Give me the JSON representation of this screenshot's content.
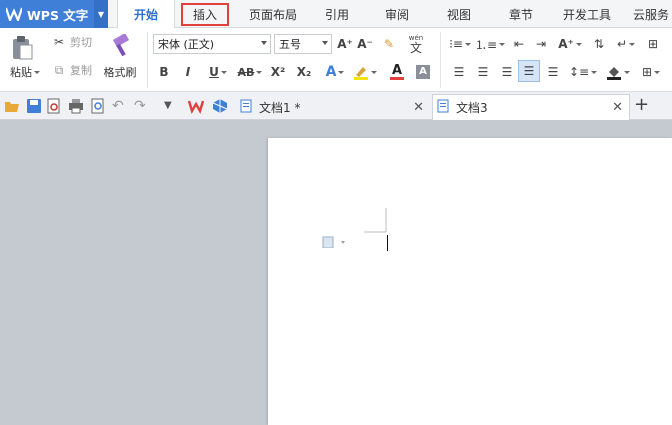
{
  "app": {
    "name": "WPS 文字"
  },
  "menu_tabs": [
    {
      "label": "开始",
      "active": true
    },
    {
      "label": "插入",
      "highlighted": true
    },
    {
      "label": "页面布局"
    },
    {
      "label": "引用"
    },
    {
      "label": "审阅"
    },
    {
      "label": "视图"
    },
    {
      "label": "章节"
    },
    {
      "label": "开发工具"
    },
    {
      "label": "云服务"
    }
  ],
  "ribbon": {
    "paste_label": "粘贴",
    "cut_label": "剪切",
    "copy_label": "复制",
    "format_painter_label": "格式刷",
    "font_name": "宋体 (正文)",
    "font_size": "五号",
    "bold": "B",
    "italic": "I",
    "underline": "U",
    "strike": "AB",
    "superscript": "X²",
    "subscript": "X₂",
    "font_color_letter": "A",
    "grow_font": "A⁺",
    "shrink_font": "A⁻",
    "phonetic_label": "wén",
    "phonetic_char": "文"
  },
  "doc_tabs": [
    {
      "label": "文档1 *",
      "active": false
    },
    {
      "label": "文档3",
      "active": true
    }
  ],
  "colors": {
    "brand_blue": "#3f7fd7",
    "highlight_red": "#e0413d",
    "wps_red": "#e0413d"
  }
}
